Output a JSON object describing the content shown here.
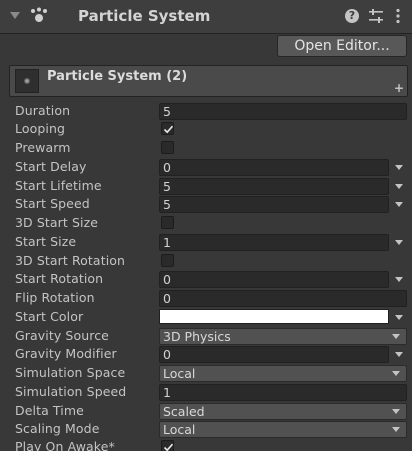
{
  "header": {
    "title": "Particle System",
    "icons": {
      "fold": "triangle-down-icon",
      "component": "particle-system-icon",
      "help": "help-icon",
      "presets": "presets-sliders-icon",
      "menu": "kebab-menu-icon"
    },
    "help_glyph": "?"
  },
  "open_editor_label": "Open Editor...",
  "module": {
    "title": "Particle System (2)",
    "plus_glyph": "+"
  },
  "props": {
    "duration": {
      "label": "Duration",
      "value": "5"
    },
    "looping": {
      "label": "Looping",
      "checked": true
    },
    "prewarm": {
      "label": "Prewarm",
      "checked": false
    },
    "start_delay": {
      "label": "Start Delay",
      "value": "0"
    },
    "start_lifetime": {
      "label": "Start Lifetime",
      "value": "5"
    },
    "start_speed": {
      "label": "Start Speed",
      "value": "5"
    },
    "start_size_3d": {
      "label": "3D Start Size",
      "checked": false
    },
    "start_size": {
      "label": "Start Size",
      "value": "1"
    },
    "start_rotation_3d": {
      "label": "3D Start Rotation",
      "checked": false
    },
    "start_rotation": {
      "label": "Start Rotation",
      "value": "0"
    },
    "flip_rotation": {
      "label": "Flip Rotation",
      "value": "0"
    },
    "start_color": {
      "label": "Start Color",
      "color": "#ffffff"
    },
    "gravity_source": {
      "label": "Gravity Source",
      "value": "3D Physics"
    },
    "gravity_modifier": {
      "label": "Gravity Modifier",
      "value": "0"
    },
    "simulation_space": {
      "label": "Simulation Space",
      "value": "Local"
    },
    "simulation_speed": {
      "label": "Simulation Speed",
      "value": "1"
    },
    "delta_time": {
      "label": "Delta Time",
      "value": "Scaled"
    },
    "scaling_mode": {
      "label": "Scaling Mode",
      "value": "Local"
    },
    "play_on_awake": {
      "label": "Play On Awake*",
      "checked": true
    }
  },
  "colors": {
    "panel_bg": "#383838",
    "field_bg": "#2a2a2a",
    "text": "#c4c4c4"
  }
}
